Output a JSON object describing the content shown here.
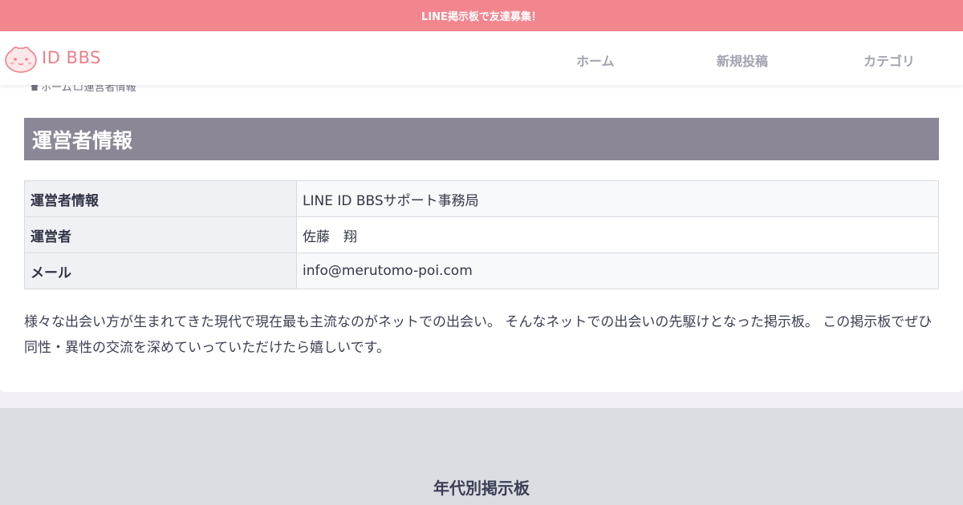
{
  "announcement": "LINE掲示板で友達募集！",
  "header": {
    "logo_text": "ID BBS",
    "nav": [
      "ホーム",
      "新規投稿",
      "カテゴリ"
    ]
  },
  "breadcrumb": {
    "home": "ホーム",
    "current": "運営者情報"
  },
  "page": {
    "title": "運営者情報",
    "table": [
      {
        "key": "運営者情報",
        "value": "LINE ID BBSサポート事務局"
      },
      {
        "key": "運営者",
        "value": "佐藤　翔"
      },
      {
        "key": "メール",
        "value": "info@merutomo-poi.com"
      }
    ],
    "intro": "様々な出会い方が生まれてきた現代で現在最も主流なのがネットでの出会い。 そんなネットでの出会いの先駆けとなった掲示板。 この掲示板でぜひ同性・異性の交流を深めていっていただけたら嬉しいです。"
  },
  "footer": {
    "heading": "年代別掲示板"
  },
  "colors": {
    "accent_pink": "#f2868f",
    "title_bar": "#8b8796",
    "footer_band": "#dcdde2"
  },
  "icons": [
    "mascot-logo-icon",
    "home-icon",
    "folder-icon"
  ]
}
